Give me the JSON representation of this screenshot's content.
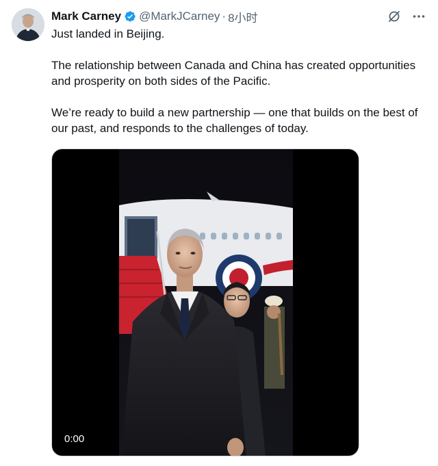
{
  "tweet": {
    "display_name": "Mark Carney",
    "handle": "@MarkJCarney",
    "separator": "·",
    "time": "8小时",
    "paragraphs": [
      "Just landed in Beijing.",
      "The relationship between Canada and China has created opportunities and prosperity on both sides of the Pacific.",
      "We’re ready to build a new partnership — one that builds on the best of our past, and responds to the challenges of today."
    ],
    "video": {
      "timestamp": "0:00"
    }
  },
  "icons": {
    "verified": "verified-badge-icon",
    "grok": "grok-icon",
    "more": "more-options-icon"
  },
  "colors": {
    "verified_blue": "#1d9bf0",
    "secondary_text": "#536471",
    "primary_text": "#0f1419"
  }
}
